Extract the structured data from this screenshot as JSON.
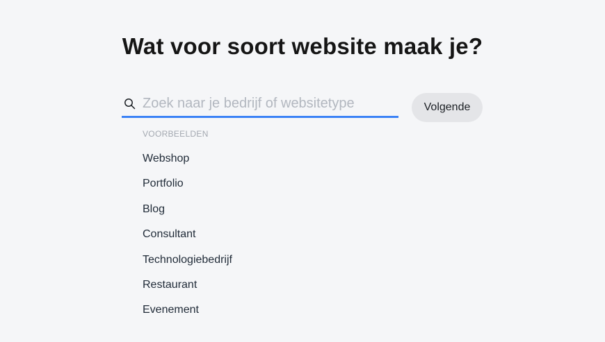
{
  "header": {
    "title": "Wat voor soort website maak je?"
  },
  "search": {
    "placeholder": "Zoek naar je bedrijf of websitetype",
    "value": "",
    "icon": "search-icon",
    "accent_color": "#3b82f6"
  },
  "actions": {
    "next_label": "Volgende"
  },
  "examples": {
    "heading": "VOORBEELDEN",
    "items": [
      "Webshop",
      "Portfolio",
      "Blog",
      "Consultant",
      "Technologiebedrijf",
      "Restaurant",
      "Evenement"
    ]
  }
}
